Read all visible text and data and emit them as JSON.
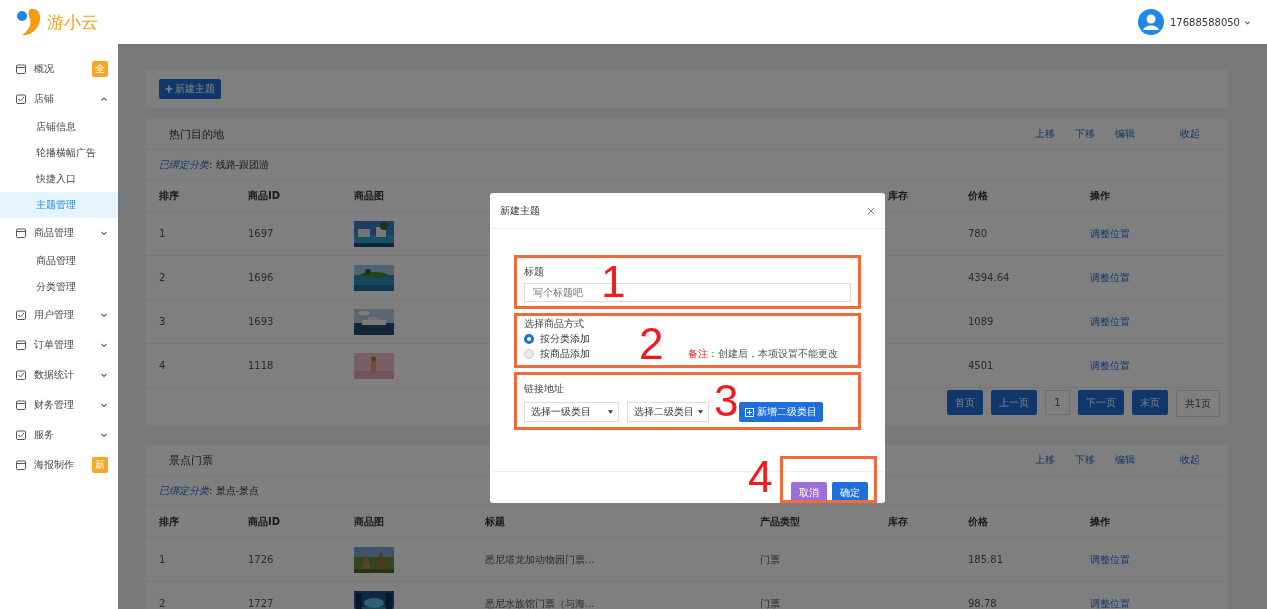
{
  "logo": {
    "name": "游小云"
  },
  "user": {
    "phone": "17688588050"
  },
  "sidebar": [
    {
      "label": "概况",
      "badge": "全"
    },
    {
      "label": "店铺",
      "expanded": true,
      "children": [
        {
          "label": "店铺信息",
          "selected": false
        },
        {
          "label": "轮播横幅广告",
          "selected": false
        },
        {
          "label": "快捷入口",
          "selected": false
        },
        {
          "label": "主题管理",
          "selected": true
        }
      ]
    },
    {
      "label": "商品管理",
      "expanded": false,
      "children": [
        {
          "label": "商品管理",
          "selected": false
        },
        {
          "label": "分类管理",
          "selected": false
        }
      ]
    },
    {
      "label": "用户管理",
      "expanded": false
    },
    {
      "label": "订单管理",
      "expanded": false
    },
    {
      "label": "数据统计",
      "expanded": false
    },
    {
      "label": "财务管理",
      "expanded": false
    },
    {
      "label": "服务",
      "expanded": false
    },
    {
      "label": "海报制作",
      "badge": "新"
    }
  ],
  "new_button": "新建主题",
  "sections": [
    {
      "title": "热门目的地",
      "actions": [
        "上移",
        "下移",
        "编辑",
        "收起"
      ],
      "bound_label": "已绑定分类",
      "bound_value": " : 线路-跟团游",
      "columns": [
        "排序",
        "商品ID",
        "商品图",
        "库存",
        "价格",
        "操作"
      ],
      "rows": [
        {
          "rank": "1",
          "id": "1697",
          "price": "780",
          "action": "调整位置"
        },
        {
          "rank": "2",
          "id": "1696",
          "price": "4394.64",
          "action": "调整位置"
        },
        {
          "rank": "3",
          "id": "1693",
          "price": "1089",
          "action": "调整位置"
        },
        {
          "rank": "4",
          "id": "1118",
          "price": "4501",
          "action": "调整位置"
        }
      ],
      "pagination": [
        {
          "label": "首页",
          "kind": "button"
        },
        {
          "label": "上一页",
          "kind": "button"
        },
        {
          "label": "1",
          "kind": "page"
        },
        {
          "label": "下一页",
          "kind": "button"
        },
        {
          "label": "末页",
          "kind": "button"
        },
        {
          "label": "共1页",
          "kind": "total"
        }
      ]
    },
    {
      "title": "景点门票",
      "actions": [
        "上移",
        "下移",
        "编辑",
        "收起"
      ],
      "bound_label": "已绑定分类",
      "bound_value": " : 景点-景点",
      "columns": [
        "排序",
        "商品ID",
        "商品图",
        "标题",
        "产品类型",
        "库存",
        "价格",
        "操作"
      ],
      "rows": [
        {
          "rank": "1",
          "id": "1726",
          "title": "悉尼塔龙加动物园门票...",
          "type": "门票",
          "price": "185.81",
          "action": "调整位置"
        },
        {
          "rank": "2",
          "id": "1727",
          "title": "悉尼水族馆门票（与海...",
          "type": "门票",
          "price": "98.78",
          "action": "调整位置"
        }
      ]
    }
  ],
  "modal": {
    "title": "新建主题",
    "fields": [
      {
        "kind": "text",
        "label": "标题",
        "placeholder": "写个标题吧"
      },
      {
        "kind": "radio",
        "label": "选择商品方式",
        "options": [
          {
            "label": "按分类添加",
            "selected": true
          },
          {
            "label": "按商品添加",
            "selected": false
          }
        ],
        "note_label": "备注",
        "note": "：创建后，本项设置不能更改"
      },
      {
        "kind": "selects",
        "label": "链接地址",
        "selects": [
          "选择一级类目",
          "选择二级类目"
        ],
        "button": "新增二级类目"
      }
    ],
    "buttons": [
      {
        "label": "取消",
        "kind": "cancel"
      },
      {
        "label": "确定",
        "kind": "confirm"
      }
    ],
    "annotations": [
      "1",
      "2",
      "3",
      "4"
    ]
  }
}
